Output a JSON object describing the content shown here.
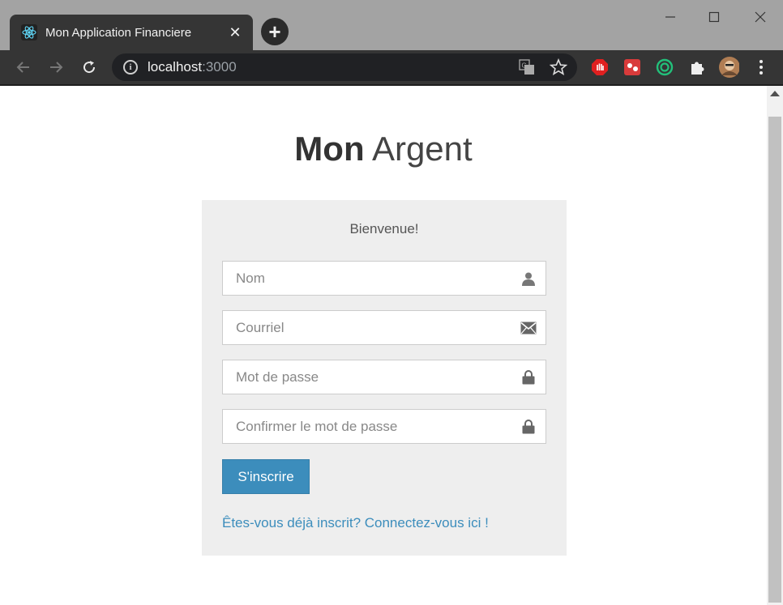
{
  "browser": {
    "tab_title": "Mon Application Financiere",
    "tab_close": "✕",
    "new_tab": "+",
    "url_host": "localhost",
    "url_port": ":3000"
  },
  "page": {
    "brand_bold": "Mon",
    "brand_light": "Argent",
    "welcome": "Bienvenue!",
    "fields": {
      "name_placeholder": "Nom",
      "email_placeholder": "Courriel",
      "password_placeholder": "Mot de passe",
      "confirm_placeholder": "Confirmer le mot de passe"
    },
    "submit_label": "S'inscrire",
    "login_link": "Êtes-vous déjà inscrit? Connectez-vous ici !"
  },
  "colors": {
    "primary": "#3c8dbc",
    "card_bg": "#eeeeee",
    "chrome_dark": "#353535"
  }
}
